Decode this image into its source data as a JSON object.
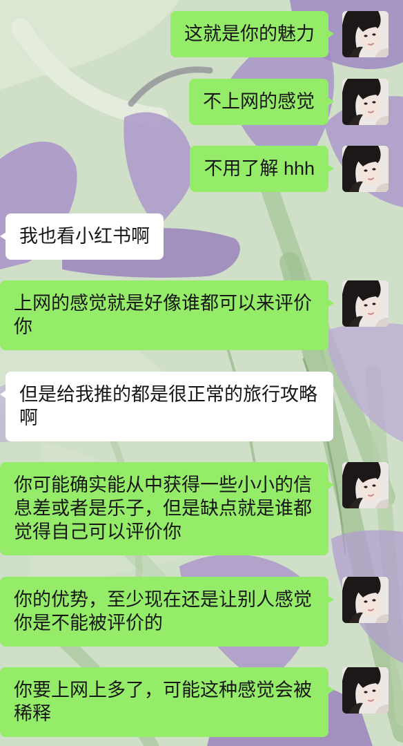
{
  "chat": {
    "messages": [
      {
        "text": "这就是你的魅力"
      },
      {
        "text": "不上网的感觉"
      },
      {
        "text": "不用了解 hhh"
      },
      {
        "text": "我也看小红书啊"
      },
      {
        "text": "上网的感觉就是好像谁都可以来评价你"
      },
      {
        "text": "但是给我推的都是很正常的旅行攻略啊"
      },
      {
        "text": "你可能确实能从中获得一些小小的信息差或者是乐子，但是缺点就是谁都觉得自己可以评价你"
      },
      {
        "text": "你的优势，至少现在还是让别人感觉你是不能被评价的"
      },
      {
        "text": "你要上网上多了，可能这种感觉会被稀释"
      }
    ]
  },
  "colors": {
    "sent_bubble": "#95ec69",
    "received_bubble": "#ffffff",
    "message_text": "#161616",
    "background_base": "#cfdfc8"
  },
  "icons": {
    "avatar": "profile-photo-icon"
  }
}
